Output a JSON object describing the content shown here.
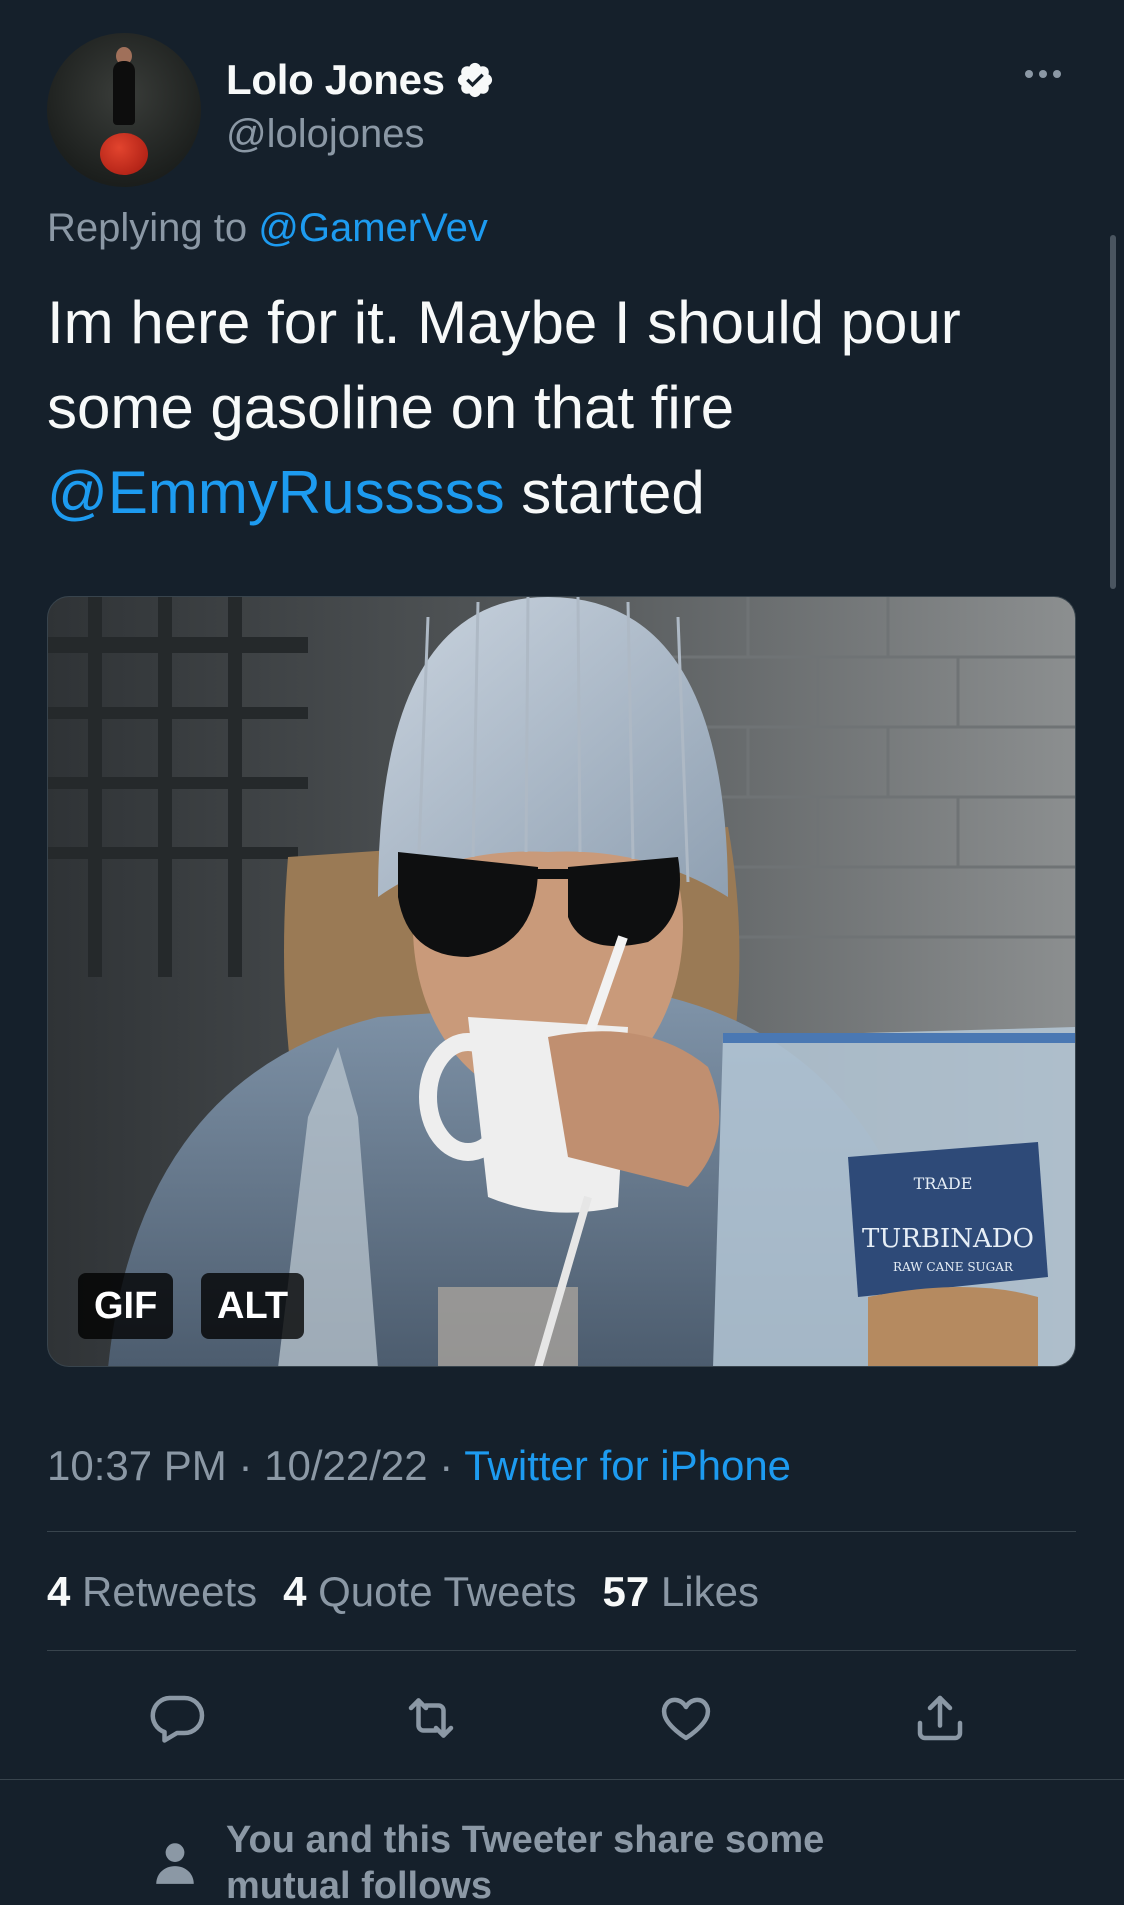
{
  "tweet": {
    "display_name": "Lolo Jones",
    "handle": "@lolojones",
    "replying_prefix": "Replying to",
    "replying_to": "@GamerVev",
    "text_part1": "Im here for it. Maybe I should pour some gasoline on that fire",
    "mention": "@EmmyRusssss",
    "text_part2": " started",
    "media": {
      "gif_badge": "GIF",
      "alt_badge": "ALT",
      "bag_text1": "TRADE",
      "bag_text2": "TURBINADO",
      "bag_text3": "RAW CANE SUGAR"
    },
    "time": "10:37 PM",
    "date": "10/22/22",
    "sep": "·",
    "source": "Twitter for iPhone",
    "retweets_count": "4",
    "retweets_label": "Retweets",
    "quotes_count": "4",
    "quotes_label": "Quote Tweets",
    "likes_count": "57",
    "likes_label": "Likes"
  },
  "footer": {
    "mutual_text": "You and this Tweeter share some mutual follows"
  },
  "icons": {
    "verified": "verified-badge-icon",
    "more": "more-options-icon",
    "reply": "reply-icon",
    "retweet": "retweet-icon",
    "like": "heart-icon",
    "share": "share-icon",
    "person": "person-icon"
  },
  "colors": {
    "background": "#15202b",
    "text": "#f7f9f9",
    "secondary": "#8b98a5",
    "accent": "#1d9bf0",
    "divider": "#38444d"
  }
}
